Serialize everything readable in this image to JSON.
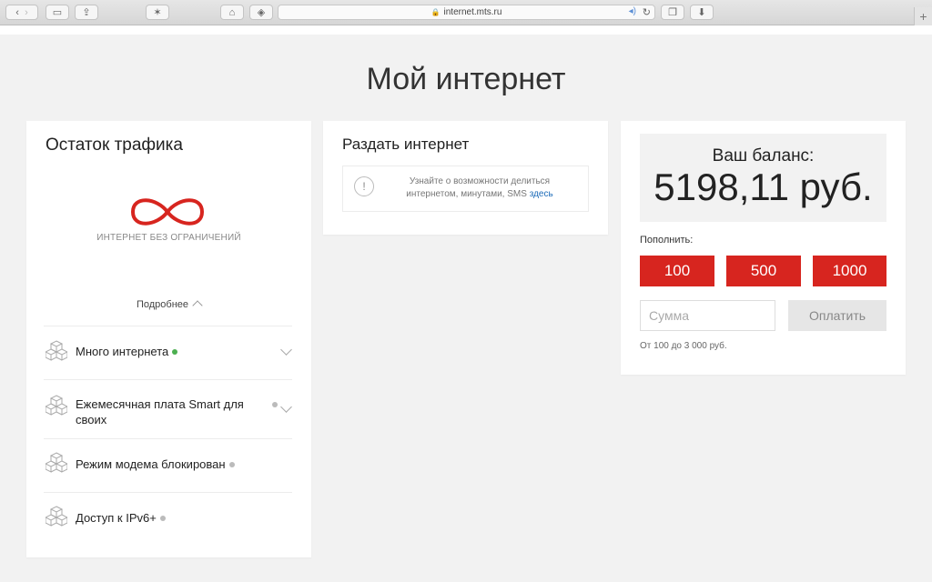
{
  "browser": {
    "url": "internet.mts.ru",
    "colors": {
      "toolbar": "#dcdcdc"
    }
  },
  "page": {
    "title": "Мой интернет"
  },
  "traffic": {
    "title": "Остаток трафика",
    "unlimited_label": "ИНТЕРНЕТ БЕЗ ОГРАНИЧЕНИЙ",
    "more_label": "Подробнее",
    "accent_color": "#d7251f",
    "items": [
      {
        "label": "Много интернета",
        "status": "green",
        "has_chevron": true
      },
      {
        "label": "Ежемесячная плата Smart для своих",
        "status": "gray",
        "has_chevron": true
      },
      {
        "label": "Режим модема блокирован",
        "status": "gray",
        "has_chevron": false
      },
      {
        "label": "Доступ к IPv6+",
        "status": "gray",
        "has_chevron": false
      }
    ]
  },
  "share": {
    "title": "Раздать интернет",
    "text": "Узнайте о возможности делиться интернетом, минутами, SMS",
    "link_label": "здесь"
  },
  "balance": {
    "label": "Ваш баланс:",
    "amount": "5198,11 руб.",
    "topup_label": "Пополнить:",
    "amounts": [
      "100",
      "500",
      "1000"
    ],
    "sum_placeholder": "Сумма",
    "pay_label": "Оплатить",
    "range_note": "От 100 до 3 000 руб.",
    "button_color": "#d7251f"
  }
}
